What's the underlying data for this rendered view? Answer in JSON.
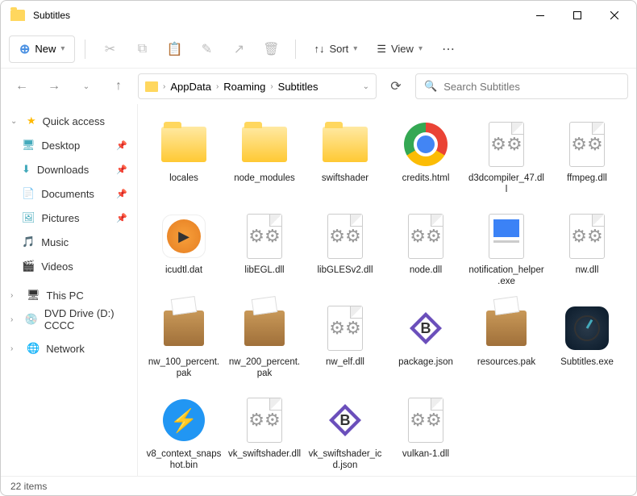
{
  "window": {
    "title": "Subtitles"
  },
  "toolbar": {
    "new_label": "New",
    "sort_label": "Sort",
    "view_label": "View"
  },
  "breadcrumb": [
    "AppData",
    "Roaming",
    "Subtitles"
  ],
  "search": {
    "placeholder": "Search Subtitles"
  },
  "sidebar": {
    "quick_access": "Quick access",
    "items": [
      "Desktop",
      "Downloads",
      "Documents",
      "Pictures",
      "Music",
      "Videos"
    ],
    "this_pc": "This PC",
    "dvd": "DVD Drive (D:) CCCC",
    "network": "Network"
  },
  "files": [
    {
      "name": "locales",
      "type": "folder"
    },
    {
      "name": "node_modules",
      "type": "folder"
    },
    {
      "name": "swiftshader",
      "type": "folder"
    },
    {
      "name": "credits.html",
      "type": "chrome"
    },
    {
      "name": "d3dcompiler_47.dll",
      "type": "dll"
    },
    {
      "name": "ffmpeg.dll",
      "type": "dll"
    },
    {
      "name": "icudtl.dat",
      "type": "dat"
    },
    {
      "name": "libEGL.dll",
      "type": "dll"
    },
    {
      "name": "libGLESv2.dll",
      "type": "dll"
    },
    {
      "name": "node.dll",
      "type": "dll"
    },
    {
      "name": "notification_helper.exe",
      "type": "exe-blue"
    },
    {
      "name": "nw.dll",
      "type": "dll"
    },
    {
      "name": "nw_100_percent.pak",
      "type": "pak"
    },
    {
      "name": "nw_200_percent.pak",
      "type": "pak"
    },
    {
      "name": "nw_elf.dll",
      "type": "dll"
    },
    {
      "name": "package.json",
      "type": "bbedit"
    },
    {
      "name": "resources.pak",
      "type": "pak"
    },
    {
      "name": "Subtitles.exe",
      "type": "subtitles"
    },
    {
      "name": "v8_context_snapshot.bin",
      "type": "bin"
    },
    {
      "name": "vk_swiftshader.dll",
      "type": "dll"
    },
    {
      "name": "vk_swiftshader_icd.json",
      "type": "bbedit"
    },
    {
      "name": "vulkan-1.dll",
      "type": "dll"
    }
  ],
  "status": {
    "count": "22 items"
  }
}
